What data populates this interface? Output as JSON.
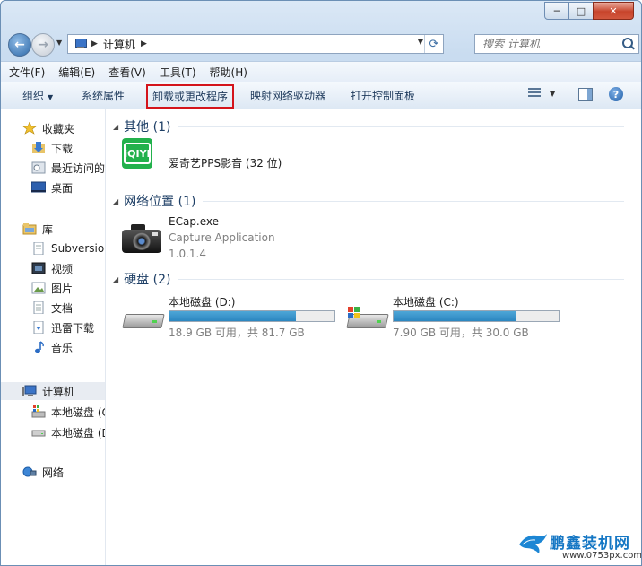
{
  "window": {
    "controls": {
      "minimize": "─",
      "maximize": "□",
      "close": "✕"
    }
  },
  "address": {
    "path": [
      "计算机"
    ],
    "search_placeholder": "搜索 计算机"
  },
  "menubar": {
    "items": [
      "文件(F)",
      "编辑(E)",
      "查看(V)",
      "工具(T)",
      "帮助(H)"
    ]
  },
  "commandbar": {
    "organize": "组织",
    "system_properties": "系统属性",
    "uninstall": "卸载或更改程序",
    "map_drive": "映射网络驱动器",
    "control_panel": "打开控制面板",
    "help": "?"
  },
  "sidebar": {
    "favorites": "收藏夹",
    "downloads": "下载",
    "recent": "最近访问的",
    "desktop": "桌面",
    "libraries": "库",
    "subversion": "Subversion",
    "videos": "视频",
    "pictures": "图片",
    "documents": "文档",
    "xunlei": "迅雷下载",
    "music": "音乐",
    "computer": "计算机",
    "disk_c": "本地磁盘 (C",
    "disk_d": "本地磁盘 (D",
    "network": "网络"
  },
  "groups": {
    "other": "其他 (1)",
    "network_location": "网络位置 (1)",
    "hard_disks": "硬盘 (2)"
  },
  "items": {
    "iqiyi": {
      "name": "爱奇艺PPS影音 (32 位)",
      "icon_text": "iQIYI"
    },
    "ecap": {
      "name": "ECap.exe",
      "description": "Capture Application",
      "version": "1.0.1.4"
    },
    "disk_d": {
      "name": "本地磁盘 (D:)",
      "space": "18.9 GB 可用，共 81.7 GB",
      "used_fraction": 0.769
    },
    "disk_c": {
      "name": "本地磁盘 (C:)",
      "space": "7.90 GB 可用，共 30.0 GB",
      "used_fraction": 0.737
    }
  },
  "watermark": {
    "title": "鹏鑫装机网",
    "url": "www.0753px.com"
  },
  "colors": {
    "bar_fill": "#2b86c0",
    "iqiyi_green": "#22b14c",
    "highlight_border": "#d4141b"
  }
}
